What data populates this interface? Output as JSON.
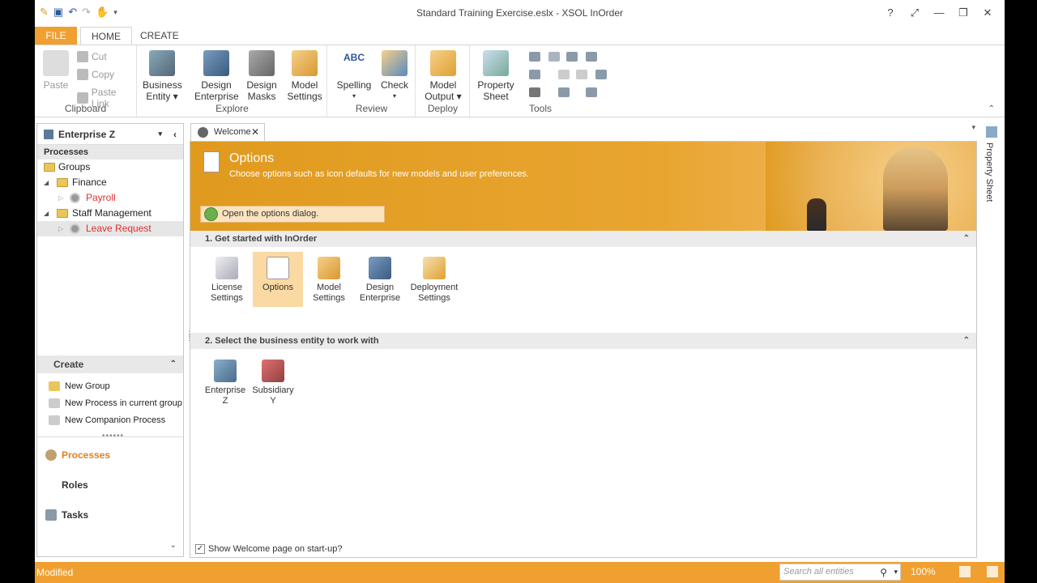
{
  "window": {
    "title": "Standard Training Exercise.eslx - XSOL InOrder",
    "controls": [
      "?",
      "⤢",
      "—",
      "❐",
      "✕"
    ]
  },
  "qat": [
    "save-icon",
    "undo-icon",
    "redo-icon",
    "touch-icon",
    "customize-icon"
  ],
  "ribbon": {
    "tabs": {
      "file": "FILE",
      "home": "HOME",
      "create": "CREATE"
    },
    "clipboard": {
      "label": "Clipboard",
      "paste": "Paste",
      "cut": "Cut",
      "copy": "Copy",
      "paste_link": "Paste Link"
    },
    "explore": {
      "label": "Explore",
      "business_entity_1": "Business",
      "business_entity_2": "Entity ▾",
      "design_enterprise_1": "Design",
      "design_enterprise_2": "Enterprise",
      "design_masks_1": "Design",
      "design_masks_2": "Masks",
      "model_settings_1": "Model",
      "model_settings_2": "Settings"
    },
    "review": {
      "label": "Review",
      "spelling": "Spelling",
      "check": "Check",
      "abc": "ABC"
    },
    "deploy": {
      "label": "Deploy",
      "model_output_1": "Model",
      "model_output_2": "Output ▾"
    },
    "tools": {
      "label": "Tools",
      "property_sheet_1": "Property",
      "property_sheet_2": "Sheet"
    }
  },
  "left_panel": {
    "header": "Enterprise Z",
    "processes_label": "Processes",
    "tree": {
      "groups": "Groups",
      "finance": "Finance",
      "payroll": "Payroll",
      "staff_management": "Staff Management",
      "leave_request": "Leave Request"
    },
    "create_label": "Create",
    "create_items": {
      "new_group": "New Group",
      "new_process": "New Process in current group",
      "new_companion": "New Companion Process"
    },
    "nav": {
      "processes": "Processes",
      "roles": "Roles",
      "tasks": "Tasks"
    }
  },
  "doc": {
    "tab_label": "Welcome",
    "banner": {
      "title": "Options",
      "subtitle": "Choose options such as icon defaults for new models and user preferences.",
      "action": "Open the options dialog."
    },
    "section1": {
      "title": "1. Get started with InOrder",
      "tiles": {
        "license_1": "License",
        "license_2": "Settings",
        "options": "Options",
        "model_1": "Model",
        "model_2": "Settings",
        "design_1": "Design",
        "design_2": "Enterprise",
        "deploy_1": "Deployment",
        "deploy_2": "Settings"
      }
    },
    "section2": {
      "title": "2. Select the business entity to work with",
      "tiles": {
        "enterprise_1": "Enterprise",
        "enterprise_2": "Z",
        "subsidiary_1": "Subsidiary",
        "subsidiary_2": "Y"
      }
    },
    "show_welcome": "Show Welcome page on start-up?"
  },
  "property_sheet_label": "Property Sheet",
  "status": {
    "state": "Modified",
    "search_placeholder": "Search all entities",
    "zoom": "100%"
  },
  "colors": {
    "accent": "#f0a030",
    "banner": "#e09a1e",
    "alert": "#e03030"
  }
}
